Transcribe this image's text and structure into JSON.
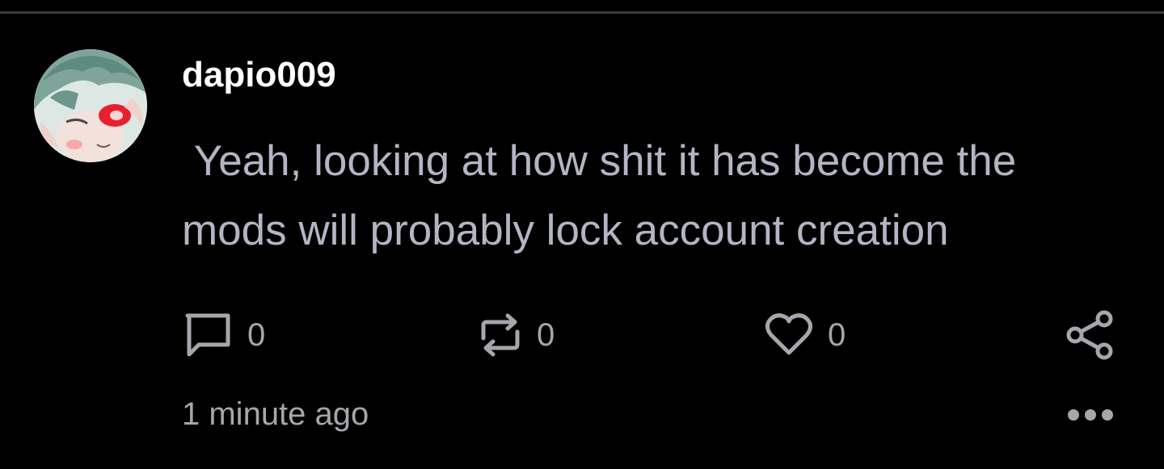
{
  "post": {
    "author": "dapio009",
    "text": " Yeah, looking at how shit it has become the mods will probably lock account creation",
    "timestamp": "1 minute ago"
  },
  "actions": {
    "reply": {
      "icon": "comment-icon",
      "count": "0"
    },
    "repost": {
      "icon": "repost-icon",
      "count": "0"
    },
    "like": {
      "icon": "heart-icon",
      "count": "0"
    },
    "share": {
      "icon": "share-icon"
    },
    "more": {
      "icon": "more-icon"
    }
  },
  "colors": {
    "background": "#000000",
    "username": "#ffffff",
    "body_text": "#b3b5c4",
    "muted": "#a6a6ac",
    "divider": "#3a3a3d"
  }
}
